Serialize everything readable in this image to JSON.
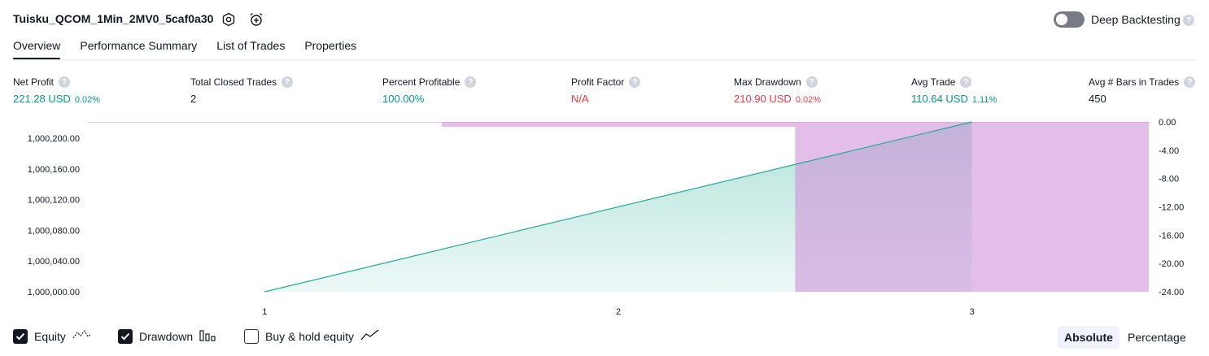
{
  "header": {
    "strategy_title": "Tuisku_QCOM_1Min_2MV0_5caf0a30",
    "settings_icon": "settings-hex-icon",
    "alert_icon": "alarm-add-icon",
    "deep_backtesting_label": "Deep Backtesting",
    "deep_backtesting_enabled": false,
    "help_glyph": "?"
  },
  "tabs": [
    {
      "label": "Overview",
      "active": true
    },
    {
      "label": "Performance Summary",
      "active": false
    },
    {
      "label": "List of Trades",
      "active": false
    },
    {
      "label": "Properties",
      "active": false
    }
  ],
  "metrics": [
    {
      "label": "Net Profit",
      "value": "221.28 USD",
      "sub": "0.02%",
      "tone": "pos"
    },
    {
      "label": "Total Closed Trades",
      "value": "2",
      "sub": "",
      "tone": "neu"
    },
    {
      "label": "Percent Profitable",
      "value": "100.00%",
      "sub": "",
      "tone": "pos"
    },
    {
      "label": "Profit Factor",
      "value": "N/A",
      "sub": "",
      "tone": "neg"
    },
    {
      "label": "Max Drawdown",
      "value": "210.90 USD",
      "sub": "0.02%",
      "tone": "neg"
    },
    {
      "label": "Avg Trade",
      "value": "110.64 USD",
      "sub": "1.11%",
      "tone": "pos"
    },
    {
      "label": "Avg # Bars in Trades",
      "value": "450",
      "sub": "",
      "tone": "neu"
    }
  ],
  "chart_data": {
    "type": "area",
    "x_ticks": [
      "1",
      "2",
      "3"
    ],
    "equity": {
      "name": "Equity",
      "color": "#22ab94",
      "points": [
        [
          1,
          1000000.0
        ],
        [
          3,
          1000221.28
        ]
      ]
    },
    "drawdown": {
      "name": "Drawdown",
      "color": "#ce93d8",
      "bars": [
        {
          "x0": 1.5,
          "x1": 2.5,
          "value": 0.0
        },
        {
          "x0": 2.5,
          "x1": 3.0,
          "value": -24.0
        },
        {
          "x0": 3.0,
          "x1": 3.5,
          "value": -24.0
        }
      ]
    },
    "left_axis": {
      "ticks": [
        "1,000,200.00",
        "1,000,160.00",
        "1,000,120.00",
        "1,000,080.00",
        "1,000,040.00",
        "1,000,000.00"
      ],
      "values": [
        1000200,
        1000160,
        1000120,
        1000080,
        1000040,
        1000000
      ],
      "range": [
        1000000,
        1000221.28
      ]
    },
    "right_axis": {
      "ticks": [
        "0.00",
        "-4.00",
        "-8.00",
        "-12.00",
        "-16.00",
        "-20.00",
        "-24.00"
      ],
      "values": [
        0,
        -4,
        -8,
        -12,
        -16,
        -20,
        -24
      ],
      "range": [
        -24,
        0
      ]
    },
    "x_range": [
      0.5,
      3.5
    ],
    "grid": false
  },
  "legend": {
    "items": [
      {
        "label": "Equity",
        "checked": true,
        "icon": "equity-line-icon"
      },
      {
        "label": "Drawdown",
        "checked": true,
        "icon": "drawdown-bars-icon"
      },
      {
        "label": "Buy & hold equity",
        "checked": false,
        "icon": "buy-hold-line-icon"
      }
    ],
    "scale_options": [
      {
        "label": "Absolute",
        "active": true
      },
      {
        "label": "Percentage",
        "active": false
      }
    ]
  }
}
